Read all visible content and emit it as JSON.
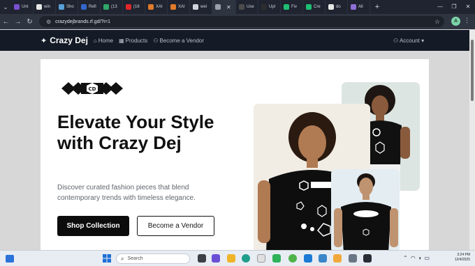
{
  "browser": {
    "tabs": [
      {
        "title": "Unt",
        "color": "#7a4fd0"
      },
      {
        "title": "win",
        "color": "#e6e6e6"
      },
      {
        "title": "Sho",
        "color": "#5aa0d8"
      },
      {
        "title": "Refi",
        "color": "#3366cc"
      },
      {
        "title": "(13",
        "color": "#2fa868"
      },
      {
        "title": "(16",
        "color": "#e0262b"
      },
      {
        "title": "XAI",
        "color": "#e07a2a"
      },
      {
        "title": "XAI",
        "color": "#e07a2a"
      },
      {
        "title": "wel",
        "color": "#cfd3da"
      },
      {
        "title": "",
        "color": "#9aa0aa",
        "active": true
      },
      {
        "title": "Use",
        "color": "#4c4c4c"
      },
      {
        "title": "Upl",
        "color": "#2d2d2d"
      },
      {
        "title": "Fiv",
        "color": "#1dbf73"
      },
      {
        "title": "Cre",
        "color": "#1dbf73"
      },
      {
        "title": "do",
        "color": "#e6e6e6"
      },
      {
        "title": "All",
        "color": "#8f6fd8"
      }
    ],
    "url": "crazydejbrands.rf.gd/?i=1",
    "profile_initial": "A"
  },
  "nav": {
    "brand": "Crazy Dej",
    "links": [
      {
        "label": "Home",
        "icon": "home-icon",
        "glyph": "⌂"
      },
      {
        "label": "Products",
        "icon": "grid-icon",
        "glyph": "▦"
      },
      {
        "label": "Become a Vendor",
        "icon": "user-plus-icon",
        "glyph": "⚇"
      }
    ],
    "account": "Account"
  },
  "hero": {
    "headline": "Elevate Your Style with Crazy Dej",
    "subtext": "Discover curated fashion pieces that blend contemporary trends with timeless elegance.",
    "primary_cta": "Shop Collection",
    "secondary_cta": "Become a Vendor",
    "logo_text": "CD"
  },
  "taskbar": {
    "search_placeholder": "Search",
    "time": "3:24 PM",
    "date": "12/4/2025"
  },
  "colors": {
    "navbar": "#141a26",
    "cta": "#0c0c0c"
  }
}
